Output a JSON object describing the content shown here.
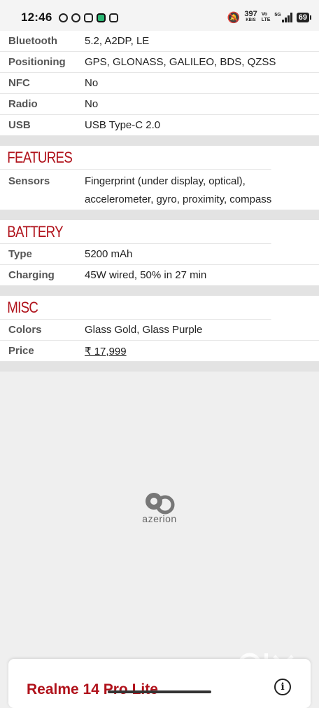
{
  "status_bar": {
    "time": "12:46",
    "net_speed": "397",
    "net_unit": "KB/S",
    "volte_top": "Vo",
    "volte_bottom": "LTE",
    "network": "5G",
    "battery": "69"
  },
  "spec_rows_top": [
    {
      "key": "Bluetooth",
      "value": "5.2, A2DP, LE"
    },
    {
      "key": "Positioning",
      "value": "GPS, GLONASS, GALILEO, BDS, QZSS"
    },
    {
      "key": "NFC",
      "value": "No"
    },
    {
      "key": "Radio",
      "value": "No"
    },
    {
      "key": "USB",
      "value": "USB Type-C 2.0"
    }
  ],
  "features": {
    "heading": "FEATURES",
    "sensors_key": "Sensors",
    "sensors_line1": "Fingerprint (under display, optical),",
    "sensors_line2": "accelerometer, gyro, proximity, compass"
  },
  "battery": {
    "heading": "BATTERY",
    "type_key": "Type",
    "type_value": "5200 mAh",
    "charging_key": "Charging",
    "charging_value": "45W wired, 50% in 27 min"
  },
  "misc": {
    "heading": "MISC",
    "colors_key": "Colors",
    "colors_value": "Glass Gold, Glass Purple",
    "price_key": "Price",
    "price_value": "₹ 17,999"
  },
  "ad": {
    "brand": "azerion"
  },
  "bottom_card": {
    "title": "Realme 14 Pro Lite",
    "info_glyph": "i"
  },
  "colors": {
    "accent": "#b0121b",
    "separator": "#e3e3e3"
  }
}
